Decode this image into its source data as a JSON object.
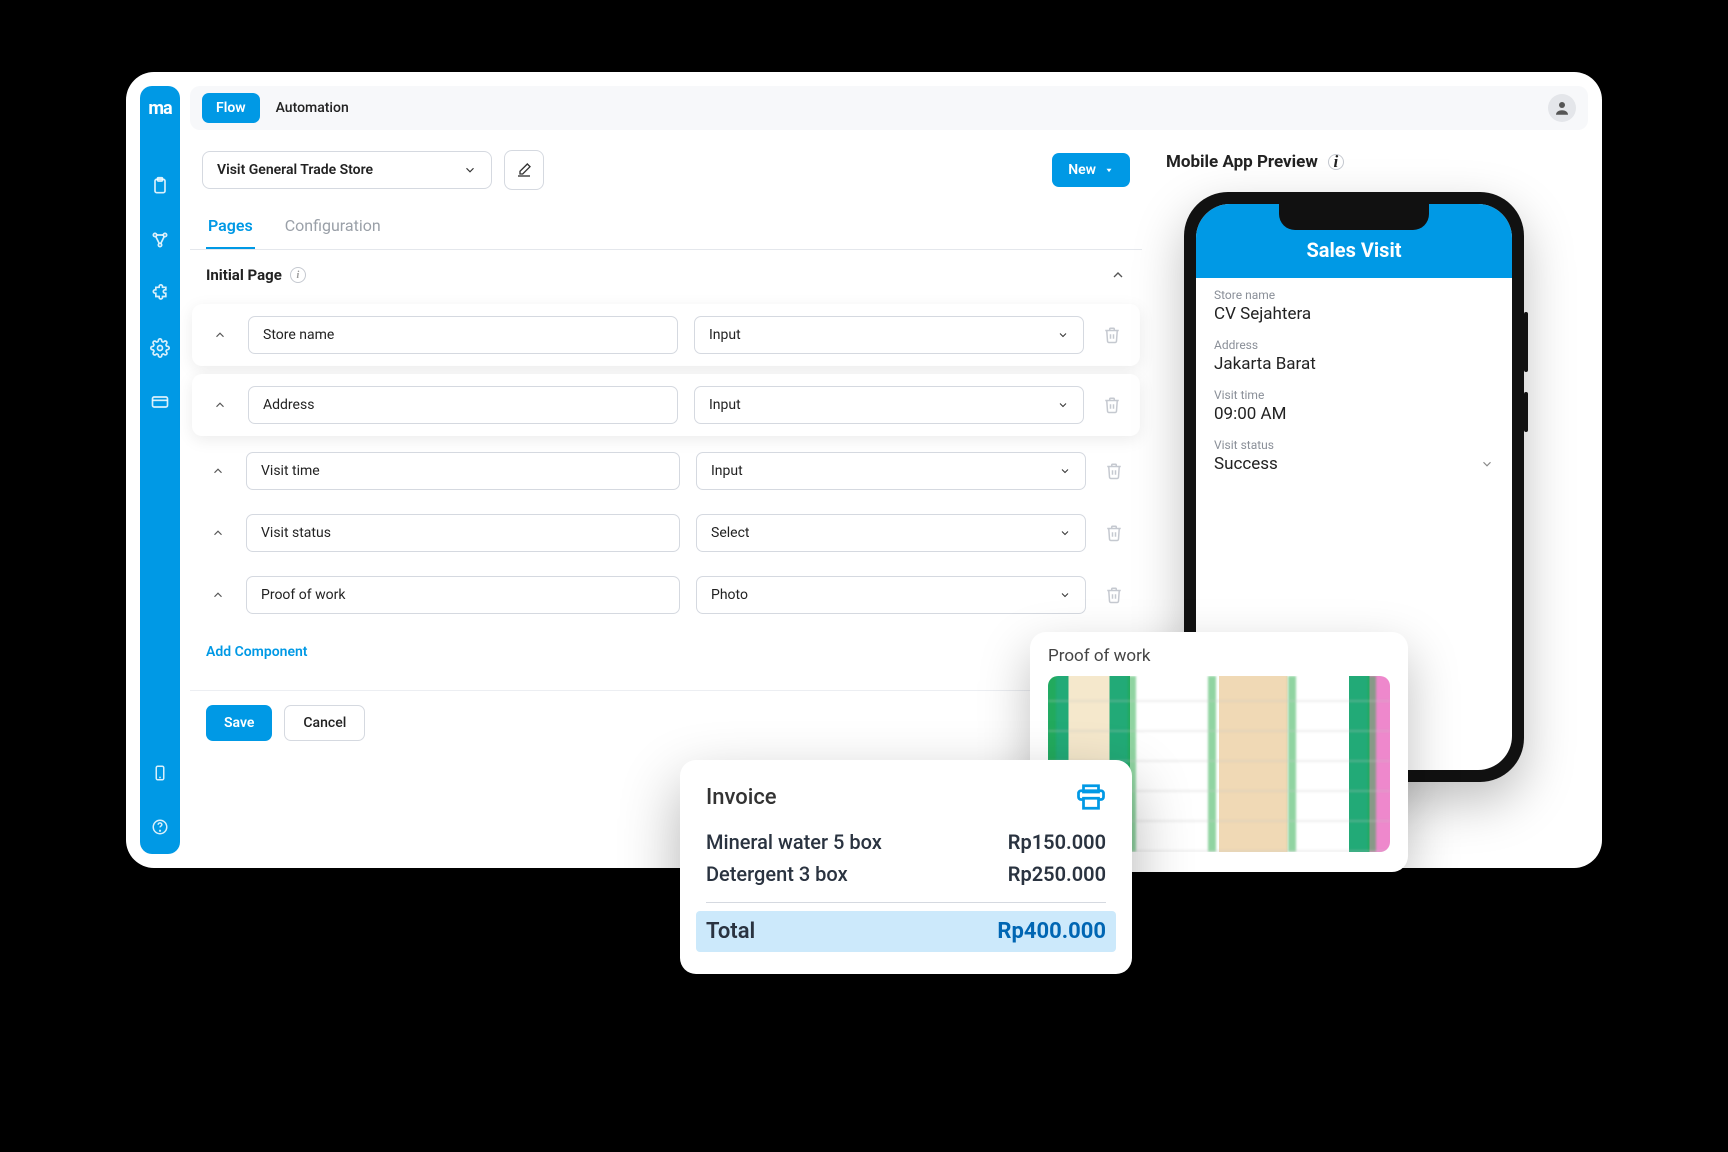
{
  "logo": "ma",
  "topbar": {
    "active_tab": "Flow",
    "other_tab": "Automation"
  },
  "toolbar": {
    "flow_name": "Visit General Trade Store",
    "new_button": "New"
  },
  "subtabs": {
    "pages": "Pages",
    "configuration": "Configuration"
  },
  "section": {
    "title": "Initial Page"
  },
  "fields": [
    {
      "label": "Store name",
      "type": "Input",
      "elevated": true
    },
    {
      "label": "Address",
      "type": "Input",
      "elevated": true
    },
    {
      "label": "Visit time",
      "type": "Input",
      "elevated": false
    },
    {
      "label": "Visit status",
      "type": "Select",
      "elevated": false
    },
    {
      "label": "Proof of work",
      "type": "Photo",
      "elevated": false
    }
  ],
  "add_component": "Add Component",
  "footer": {
    "save": "Save",
    "cancel": "Cancel"
  },
  "preview": {
    "title": "Mobile App Preview",
    "app_title": "Sales Visit",
    "fields": [
      {
        "label": "Store name",
        "value": "CV Sejahtera"
      },
      {
        "label": "Address",
        "value": "Jakarta Barat"
      },
      {
        "label": "Visit time",
        "value": "09:00 AM"
      },
      {
        "label": "Visit status",
        "value": "Success"
      }
    ]
  },
  "proof": {
    "label": "Proof of work"
  },
  "invoice": {
    "title": "Invoice",
    "items": [
      {
        "desc": "Mineral water 5 box",
        "price": "Rp150.000"
      },
      {
        "desc": "Detergent 3 box",
        "price": "Rp250.000"
      }
    ],
    "total_label": "Total",
    "total_value": "Rp400.000"
  }
}
